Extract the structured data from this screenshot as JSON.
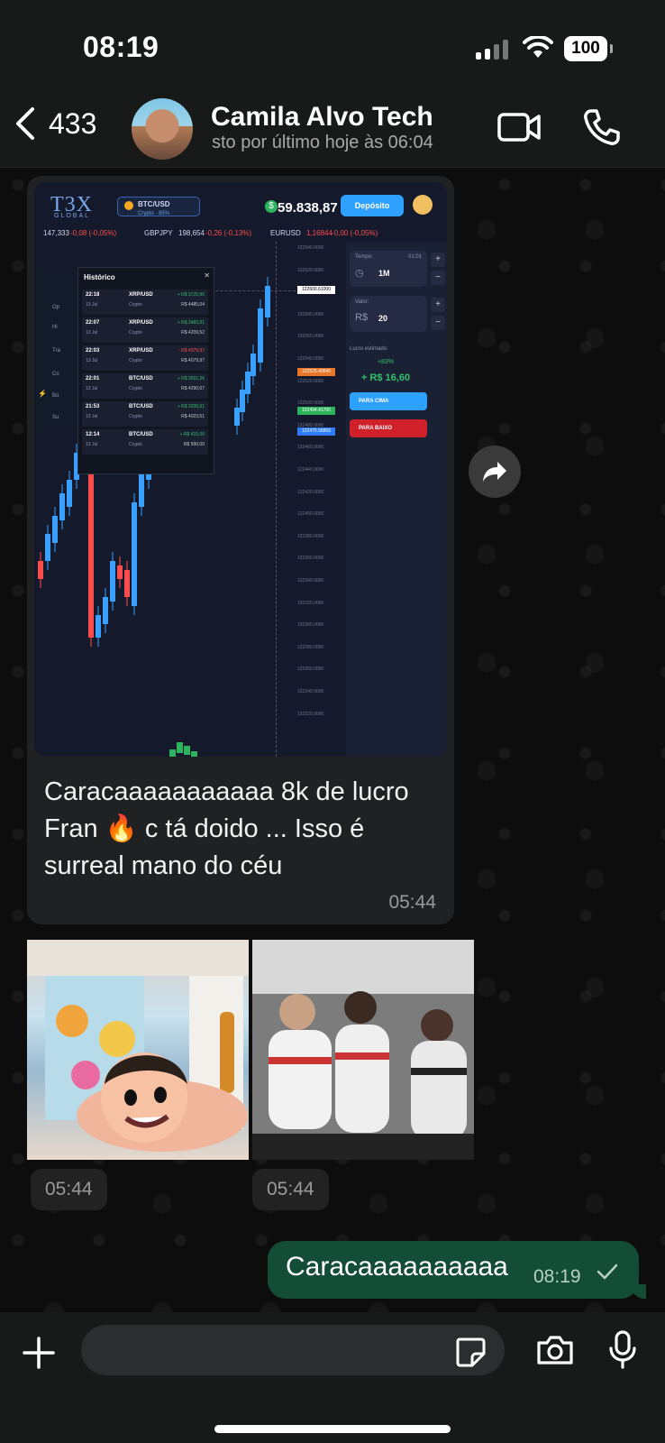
{
  "status_bar": {
    "time": "08:19",
    "battery": "100"
  },
  "header": {
    "back_count": "433",
    "contact_name": "Camila Alvo Tech",
    "last_seen": "sto por último hoje às 06:04"
  },
  "messages": {
    "incoming": {
      "caption": "Caracaaaaaaaaaaa 8k de lucro Fran 🔥 c tá doido ... Isso é surreal mano do céu",
      "time": "05:44"
    },
    "stickers": [
      {
        "time": "05:44"
      },
      {
        "time": "05:44"
      }
    ],
    "outgoing": {
      "text": "Caracaaaaaaaaaa",
      "time": "08:19"
    }
  },
  "composer": {
    "placeholder": ""
  },
  "trading_screenshot": {
    "logo": "T3X",
    "logo_sub": "GLOBAL",
    "pair": "BTC/USD",
    "pair_sub": "Crypto · 85%",
    "balance": "59.838,87",
    "deposit_label": "Depósito",
    "ticker": [
      {
        "text": "147,333",
        "cls": ""
      },
      {
        "text": "-0,08 (-0,05%)",
        "cls": "red"
      },
      {
        "text": "GBPJPY",
        "cls": ""
      },
      {
        "text": "198,654",
        "cls": ""
      },
      {
        "text": "-0,26 (-0,13%)",
        "cls": "red"
      },
      {
        "text": "EURUSD",
        "cls": ""
      },
      {
        "text": "1,16844",
        "cls": "red"
      },
      {
        "text": "-0,00 (-0,05%)",
        "cls": "red"
      }
    ],
    "time_label": "Tempo:",
    "time_countdown": "01:01",
    "time_value": "1M",
    "value_label": "Valor:",
    "currency": "R$",
    "amount": "20",
    "estimated_label": "Lucro estimado:",
    "payout_pct": "+83%",
    "estimated_profit": "+ R$ 16,60",
    "up_label": "PARA CIMA",
    "down_label": "PARA BAIXO",
    "history_title": "Histórico",
    "history": [
      {
        "time": "22:18",
        "date": "13 Jul",
        "pair": "XRP/USD",
        "type": "Crypto",
        "result": "+ R$ 3725,90",
        "amount": "R$ 4485,04",
        "win": true
      },
      {
        "time": "22:07",
        "date": "13 Jul",
        "pair": "XRP/USD",
        "type": "Crypto",
        "result": "+ R$ 3483,91",
        "amount": "R$ 4209,52",
        "win": true
      },
      {
        "time": "22:03",
        "date": "13 Jul",
        "pair": "XRP/USD",
        "type": "Crypto",
        "result": "- R$ 4079,97",
        "amount": "R$ 4079,97",
        "win": false
      },
      {
        "time": "22:01",
        "date": "13 Jul",
        "pair": "BTC/USD",
        "type": "Crypto",
        "result": "+ R$ 3561,26",
        "amount": "R$ 4290,67",
        "win": true
      },
      {
        "time": "21:53",
        "date": "13 Jul",
        "pair": "BTC/USD",
        "type": "Crypto",
        "result": "+ R$ 3339,91",
        "amount": "R$ 4023,51",
        "win": true
      },
      {
        "time": "12:14",
        "date": "13 Jul",
        "pair": "BTC/USD",
        "type": "Crypto",
        "result": "+ R$ 415,00",
        "amount": "R$ 500,00",
        "win": true
      }
    ],
    "sidebar": [
      "Op",
      "Hi",
      "Tra",
      "Co",
      "Bo",
      "Su"
    ],
    "price_labels": [
      "122640.0000",
      "122620.0000",
      "122600.0000",
      "122580.0000",
      "122560.0000",
      "122540.0000",
      "122520.0000",
      "122500.0000",
      "122480.0000",
      "122460.0000",
      "122440.0000",
      "122420.0000",
      "122400.0000",
      "122380.0000",
      "122360.0000",
      "122340.0000",
      "122320.0000",
      "122300.0000",
      "122280.0000",
      "122260.0000",
      "122240.0000",
      "122220.0000"
    ],
    "price_tags": [
      {
        "text": "122600.61000",
        "color": "#ffffff",
        "fg": "#000000"
      },
      {
        "text": "122525.40640",
        "color": "#e8772a",
        "fg": "#ffffff"
      },
      {
        "text": "122494.41700",
        "color": "#2db35d",
        "fg": "#ffffff"
      },
      {
        "text": "122475.56858",
        "color": "#2e7cff",
        "fg": "#ffffff"
      }
    ]
  }
}
